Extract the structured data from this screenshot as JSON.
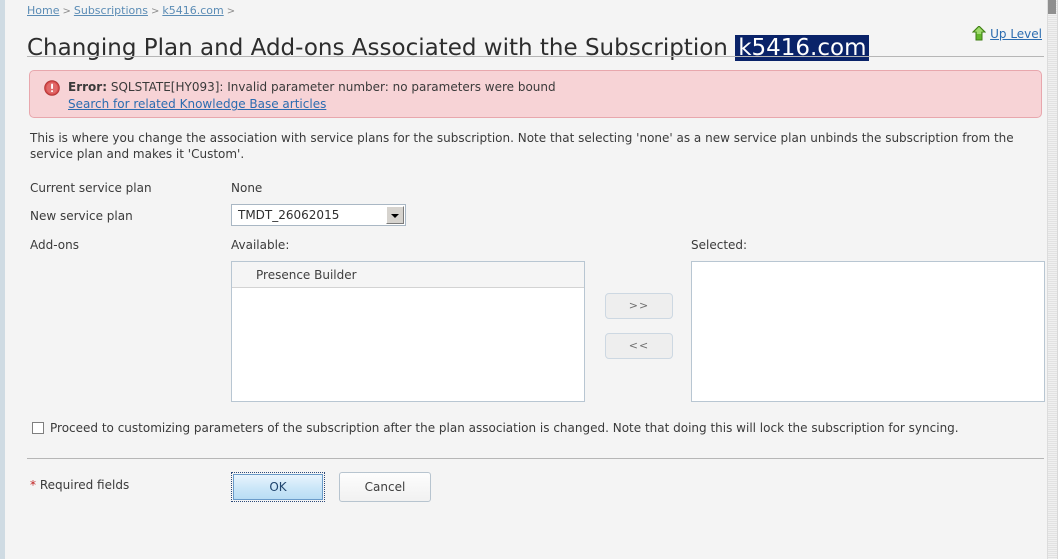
{
  "breadcrumb": {
    "items": [
      {
        "label": "Home"
      },
      {
        "label": "Subscriptions"
      },
      {
        "label": "k5416.com"
      }
    ],
    "separator": ">",
    "trailing_separator": ">"
  },
  "header": {
    "title_prefix": "Changing Plan and Add-ons Associated with the Subscription",
    "title_highlight": "k5416.com",
    "up_level_label": "Up Level",
    "up_level_icon": "up-arrow-icon"
  },
  "error": {
    "icon": "error-exclamation-icon",
    "label": "Error:",
    "message": "SQLSTATE[HY093]: Invalid parameter number: no parameters were bound",
    "kb_link": "Search for related Knowledge Base articles",
    "background_color": "#f7d3d6",
    "border_color": "#e8a7ad"
  },
  "description": "This is where you change the association with service plans for the subscription. Note that selecting 'none' as a new service plan unbinds the subscription from the service plan and makes it 'Custom'.",
  "form": {
    "current_plan_label": "Current service plan",
    "current_plan_value": "None",
    "new_plan_label": "New service plan",
    "new_plan_selected": "TMDT_26062015",
    "addons_label": "Add-ons",
    "available_label": "Available:",
    "selected_label": "Selected:",
    "available_items": [
      {
        "label": "Presence Builder"
      }
    ],
    "selected_items": [],
    "add_button_label": ">>",
    "remove_button_label": "<<"
  },
  "options": {
    "proceed_checkbox_label": "Proceed to customizing parameters of the subscription after the plan association is changed. Note that doing this will lock the subscription for syncing.",
    "proceed_checkbox_checked": false
  },
  "footer": {
    "required_star": "*",
    "required_label": "Required fields",
    "ok_label": "OK",
    "cancel_label": "Cancel"
  }
}
